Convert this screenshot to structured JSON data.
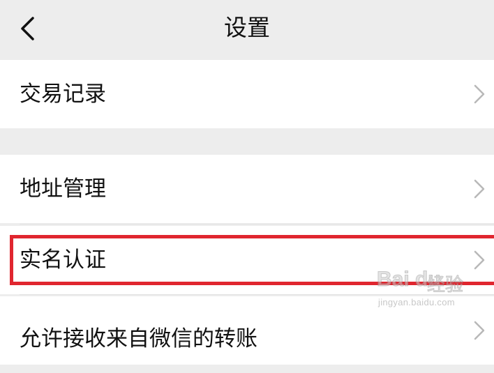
{
  "header": {
    "title": "设置",
    "back_icon": "chevron-left-icon"
  },
  "rows": [
    {
      "label": "交易记录",
      "icon": "chevron-right-icon"
    },
    {
      "label": "地址管理",
      "icon": "chevron-right-icon"
    },
    {
      "label": "实名认证",
      "icon": "chevron-right-icon"
    },
    {
      "label": "允许接收来自微信的转账",
      "icon": "chevron-right-icon"
    }
  ],
  "highlight": {
    "color": "#e0262f",
    "target": "实名认证"
  },
  "watermark": {
    "brand": "Bai du",
    "text": "经验",
    "url": "jingyan.baidu.com"
  }
}
